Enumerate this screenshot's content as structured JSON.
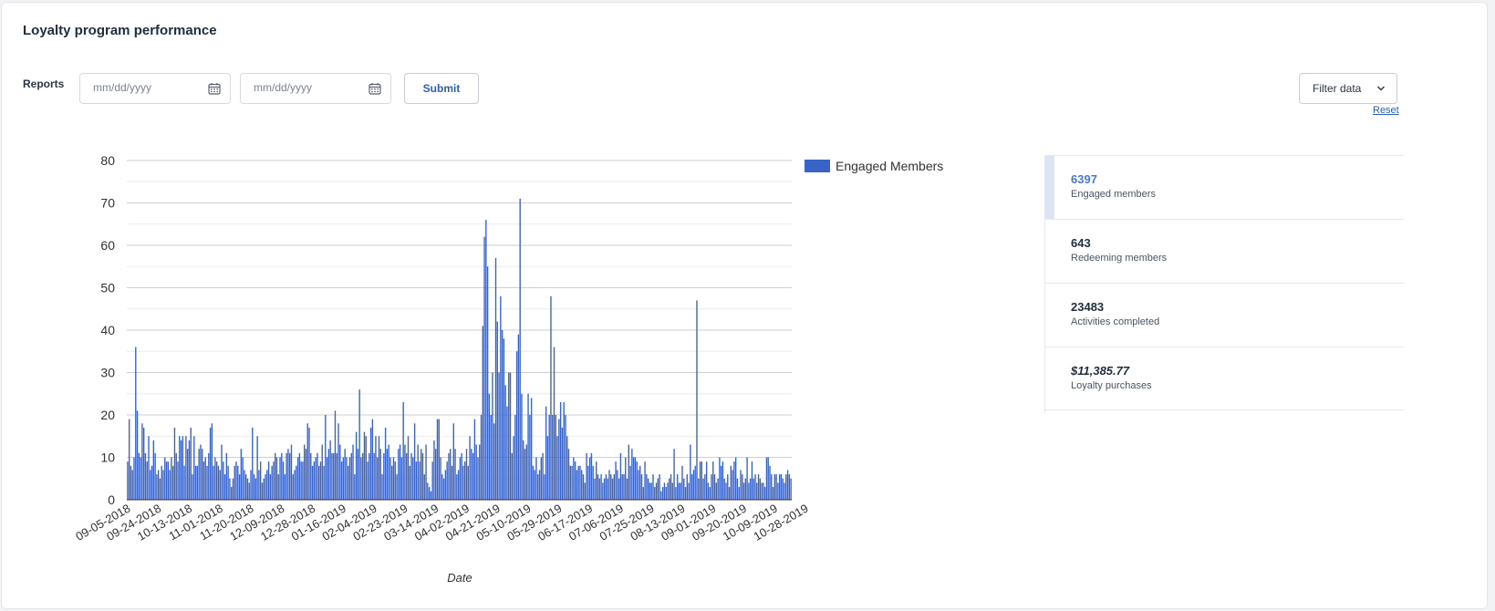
{
  "title": "Loyalty program performance",
  "filters": {
    "reports_label": "Reports",
    "start_placeholder": "mm/dd/yyyy",
    "end_placeholder": "mm/dd/yyyy",
    "submit_label": "Submit",
    "filter_label": "Filter data",
    "reset_label": "Reset"
  },
  "stats": [
    {
      "value": "6397",
      "label": "Engaged members"
    },
    {
      "value": "643",
      "label": "Redeeming members"
    },
    {
      "value": "23483",
      "label": "Activities completed"
    },
    {
      "value": "$11,385.77",
      "label": "Loyalty purchases"
    }
  ],
  "colors": {
    "bar": "#3a63c8",
    "accent": "#4a78d0",
    "link": "#2862b8"
  },
  "chart_data": {
    "type": "bar",
    "xlabel": "Date",
    "ylabel": "",
    "ylim": [
      0,
      80
    ],
    "yticks": [
      0,
      10,
      20,
      30,
      40,
      50,
      60,
      70,
      80
    ],
    "legend": {
      "label": "Engaged Members",
      "position": "top-right"
    },
    "grid": true,
    "x_tick_labels": [
      "09-05-2018",
      "09-24-2018",
      "10-13-2018",
      "11-01-2018",
      "11-20-2018",
      "12-09-2018",
      "12-28-2018",
      "01-16-2019",
      "02-04-2019",
      "02-23-2019",
      "03-14-2019",
      "04-02-2019",
      "04-21-2019",
      "05-10-2019",
      "05-29-2019",
      "06-17-2019",
      "07-06-2019",
      "07-25-2019",
      "08-13-2019",
      "09-01-2019",
      "09-20-2019",
      "10-09-2019",
      "10-28-2019"
    ],
    "series": [
      {
        "name": "Engaged Members",
        "start_date": "09-05-2018",
        "values": [
          9,
          19,
          8,
          7,
          10,
          36,
          21,
          11,
          10,
          18,
          17,
          11,
          9,
          15,
          7,
          8,
          14,
          11,
          6,
          7,
          5,
          8,
          7,
          10,
          9,
          9,
          7,
          10,
          8,
          17,
          11,
          9,
          15,
          14,
          15,
          8,
          15,
          12,
          14,
          17,
          6,
          15,
          8,
          8,
          12,
          13,
          12,
          9,
          10,
          8,
          11,
          17,
          18,
          8,
          10,
          9,
          8,
          7,
          13,
          9,
          6,
          11,
          8,
          5,
          3,
          5,
          8,
          9,
          8,
          6,
          12,
          10,
          7,
          6,
          5,
          4,
          7,
          17,
          6,
          5,
          15,
          7,
          9,
          4,
          5,
          6,
          7,
          9,
          6,
          8,
          9,
          11,
          10,
          6,
          10,
          11,
          9,
          6,
          11,
          12,
          11,
          13,
          6,
          7,
          8,
          10,
          11,
          9,
          9,
          13,
          12,
          18,
          17,
          11,
          8,
          9,
          10,
          11,
          8,
          9,
          13,
          8,
          20,
          10,
          12,
          14,
          11,
          11,
          21,
          11,
          18,
          13,
          9,
          10,
          12,
          10,
          8,
          10,
          11,
          13,
          6,
          16,
          12,
          26,
          10,
          11,
          16,
          15,
          9,
          11,
          17,
          19,
          11,
          15,
          10,
          15,
          12,
          6,
          11,
          17,
          12,
          13,
          10,
          8,
          10,
          9,
          6,
          12,
          13,
          10,
          23,
          13,
          11,
          15,
          8,
          11,
          10,
          18,
          9,
          13,
          9,
          12,
          11,
          6,
          13,
          4,
          3,
          2,
          9,
          14,
          12,
          19,
          19,
          10,
          6,
          5,
          7,
          9,
          11,
          12,
          8,
          18,
          12,
          6,
          7,
          10,
          11,
          8,
          9,
          12,
          8,
          15,
          12,
          11,
          19,
          13,
          10,
          13,
          20,
          41,
          62,
          66,
          55,
          25,
          20,
          30,
          18,
          57,
          42,
          30,
          48,
          40,
          38,
          27,
          22,
          30,
          30,
          11,
          15,
          20,
          35,
          39,
          71,
          25,
          14,
          12,
          13,
          25,
          20,
          24,
          8,
          7,
          10,
          6,
          7,
          10,
          11,
          6,
          22,
          15,
          20,
          48,
          20,
          36,
          20,
          15,
          19,
          23,
          17,
          23,
          20,
          15,
          12,
          8,
          8,
          10,
          9,
          7,
          8,
          8,
          7,
          6,
          4,
          11,
          8,
          10,
          11,
          8,
          5,
          9,
          6,
          5,
          6,
          4,
          5,
          6,
          5,
          7,
          6,
          5,
          6,
          9,
          7,
          5,
          11,
          6,
          6,
          10,
          5,
          13,
          8,
          12,
          10,
          10,
          9,
          7,
          8,
          6,
          3,
          9,
          6,
          5,
          4,
          4,
          6,
          3,
          4,
          5,
          6,
          2,
          3,
          4,
          3,
          4,
          5,
          6,
          4,
          12,
          3,
          6,
          4,
          4,
          8,
          5,
          3,
          6,
          4,
          13,
          6,
          7,
          8,
          47,
          5,
          9,
          9,
          5,
          6,
          9,
          4,
          3,
          6,
          9,
          6,
          4,
          5,
          10,
          8,
          9,
          5,
          4,
          6,
          3,
          8,
          7,
          9,
          10,
          5,
          3,
          7,
          6,
          4,
          5,
          10,
          4,
          5,
          9,
          5,
          6,
          4,
          6,
          5,
          4,
          4,
          3,
          10,
          10,
          8,
          6,
          3,
          6,
          6,
          4,
          6,
          6,
          5,
          4,
          6,
          7,
          6,
          5
        ]
      }
    ]
  }
}
